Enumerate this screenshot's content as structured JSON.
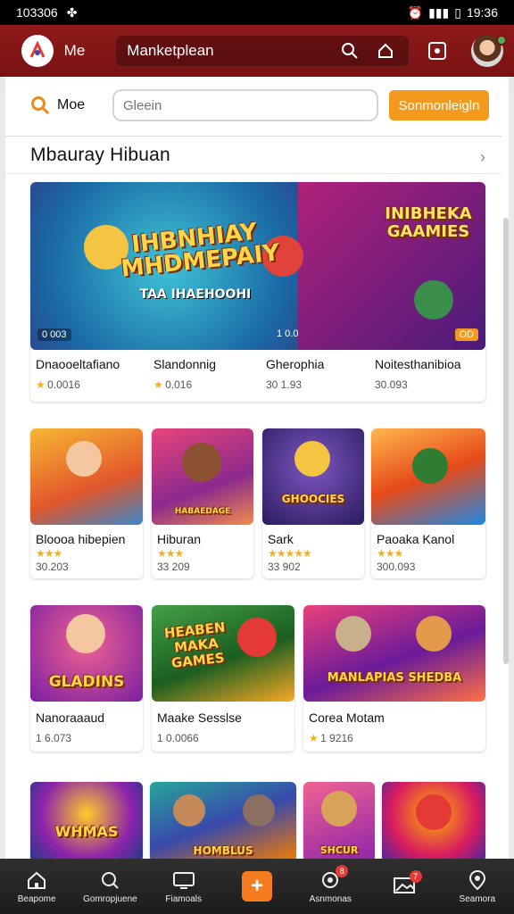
{
  "status_bar": {
    "time_left": "103306",
    "time_right": "19:36"
  },
  "app_bar": {
    "brand": "Me",
    "search_text": "Manketplean",
    "icons": [
      "search-icon",
      "home-icon",
      "record-icon"
    ]
  },
  "toolbar": {
    "more_label": "Moe",
    "search_placeholder": "Gleein",
    "cta_label": "Sonmonleigln"
  },
  "section": {
    "title": "Mbauray Hibuan"
  },
  "hero": {
    "headline": "IHBNHIAY MHDMEPAIY",
    "subline": "TAA IHAEHOOHI",
    "right_headline": "INIBHEKA GAAMIES",
    "badge_left": "0 003",
    "badge_mid": "1 0.0",
    "badge_right": "OD",
    "items": [
      {
        "name": "Dnaooeltafiano",
        "meta": "0.0016"
      },
      {
        "name": "Slandonnig",
        "meta": "0.016"
      },
      {
        "name": "Gherophia",
        "meta": "30 1.93"
      },
      {
        "name": "Noitesthanibioa",
        "meta": "30.093"
      }
    ]
  },
  "row2": [
    {
      "name": "Bloooa hibepien",
      "meta": "30.203",
      "stars": "★★★",
      "caption": ""
    },
    {
      "name": "Hiburan",
      "meta": "33 209",
      "stars": "★★★",
      "caption": "HABAEDAGE"
    },
    {
      "name": "Sark",
      "meta": "33 902",
      "stars": "★★★★★",
      "caption": "GHOOCIES"
    },
    {
      "name": "Paoaka Kanol",
      "meta": "300.093",
      "stars": "★★★",
      "caption": ""
    }
  ],
  "row3": [
    {
      "name": "Nanoraaaud",
      "meta": "1 6.073",
      "caption": "GLADINS"
    },
    {
      "name": "Maake Sesslse",
      "meta": "1 0.0066",
      "caption": "HEABEN MAKA GAMES"
    },
    {
      "name": "Corea Motam",
      "meta": "1 9216",
      "caption": "MANLAPIAS SHEDBA"
    }
  ],
  "row4": [
    {
      "caption": "WHMAS"
    },
    {
      "caption": "HOMBLUS"
    },
    {
      "caption": "SHCUR"
    },
    {
      "caption": ""
    }
  ],
  "bottom_nav": [
    {
      "label": "Beapome",
      "icon": "home-icon",
      "badge": ""
    },
    {
      "label": "Gomropjuene",
      "icon": "search-icon",
      "badge": ""
    },
    {
      "label": "Fiamoals",
      "icon": "monitor-icon",
      "badge": ""
    },
    {
      "label": "",
      "icon": "plus-icon",
      "badge": ""
    },
    {
      "label": "Asnmonas",
      "icon": "circle-icon",
      "badge": "8"
    },
    {
      "label": "",
      "icon": "image-icon",
      "badge": "7"
    },
    {
      "label": "Seamora",
      "icon": "location-icon",
      "badge": ""
    }
  ]
}
